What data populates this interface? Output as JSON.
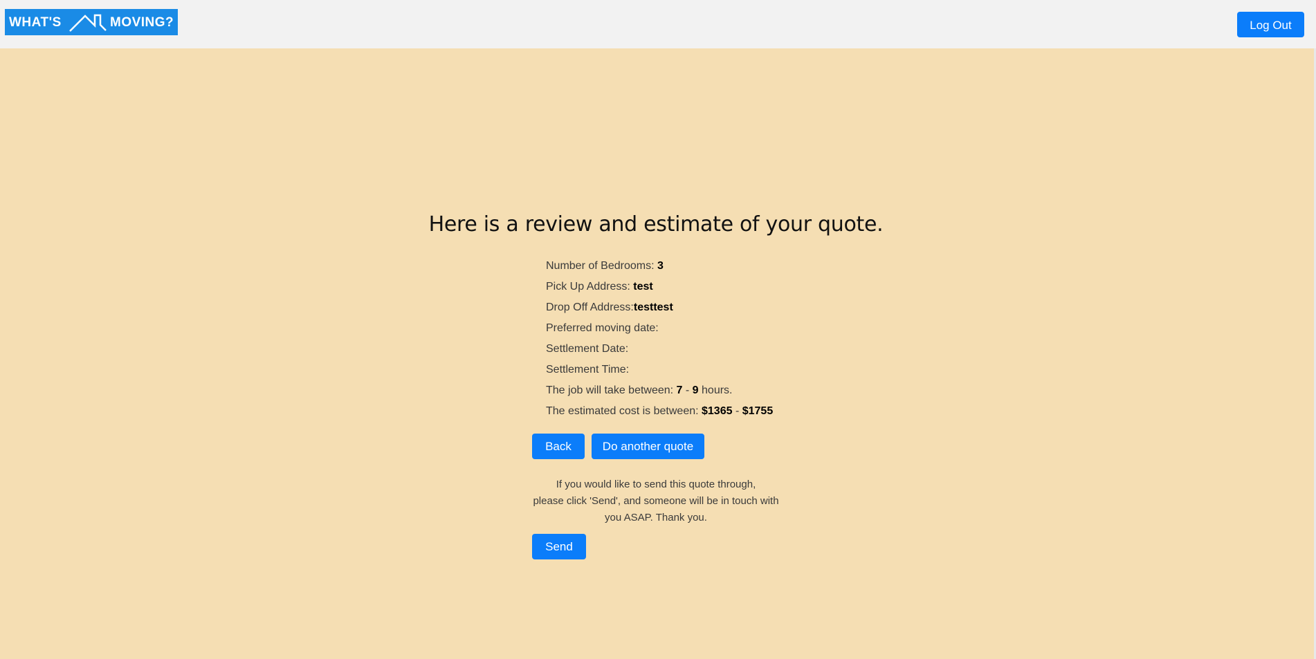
{
  "header": {
    "logo_word_left": "WHAT'S",
    "logo_word_right": "MOVING?",
    "logout_label": "Log Out"
  },
  "main": {
    "heading": "Here is a review and estimate of your quote.",
    "details": {
      "bedrooms_label": "Number of Bedrooms: ",
      "bedrooms_value": "3",
      "pickup_label": "Pick Up Address: ",
      "pickup_value": "test",
      "dropoff_label": "Drop Off Address:",
      "dropoff_value": "testtest",
      "preferred_date_label": "Preferred moving date:",
      "settlement_date_label": "Settlement Date:",
      "settlement_time_label": "Settlement Time:",
      "duration_label": "The job will take between: ",
      "duration_min": "7",
      "duration_sep": " - ",
      "duration_max": "9",
      "duration_unit": " hours.",
      "cost_label": "The estimated cost is between: ",
      "cost_min": "$1365",
      "cost_sep": " - ",
      "cost_max": "$1755"
    },
    "back_label": "Back",
    "another_quote_label": "Do another quote",
    "note_lines": [
      "If you would like to send this quote through,",
      "please click 'Send', and someone will be in touch with",
      "you ASAP. Thank you."
    ],
    "send_label": "Send"
  },
  "colors": {
    "primary_button": "#0b7dfa",
    "logo_background": "#1a8be6",
    "page_background": "#f5deb3",
    "navbar_background": "#f2f2f2"
  }
}
